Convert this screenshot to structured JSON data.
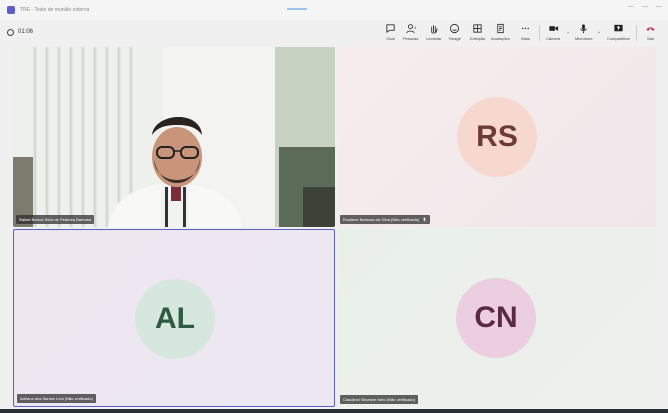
{
  "window": {
    "title": "TRE - Teste de reunião externa"
  },
  "toolbar": {
    "timer": "01:06",
    "people_count": "4",
    "tools": [
      {
        "label": "Chat"
      },
      {
        "label": "Pessoas"
      },
      {
        "label": "Levantar"
      },
      {
        "label": "Reagir"
      },
      {
        "label": "Exibição"
      },
      {
        "label": "Anotações"
      },
      {
        "label": "Mais"
      },
      {
        "label": "Câmera"
      },
      {
        "label": "Microfone"
      },
      {
        "label": "Compartilhar"
      },
      {
        "label": "Sair"
      }
    ]
  },
  "participants": [
    {
      "name": "Rafael Barros Silva de Pedreira Barbosa"
    },
    {
      "initials": "RS",
      "name": "Rosilene Barbosa da Silva (Não verificado)"
    },
    {
      "initials": "AL",
      "name": "Adriano dos Santos Leal (Não verificado)"
    },
    {
      "initials": "CN",
      "name": "Claudinei Silvestre Neto (Não verificado)"
    }
  ],
  "colors": {
    "accent": "#5b5fc7",
    "leave": "#c4314b"
  }
}
